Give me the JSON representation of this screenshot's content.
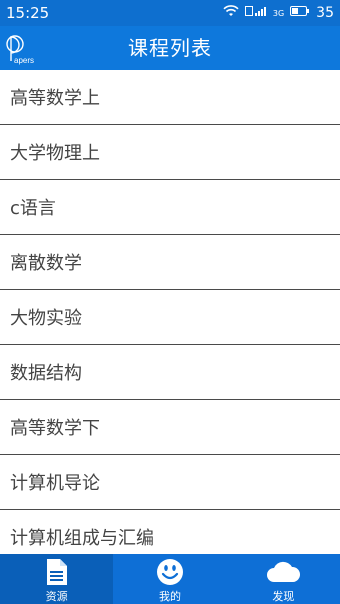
{
  "status_bar": {
    "time": "15:25",
    "battery": "35",
    "network": "3G"
  },
  "header": {
    "title": "课程列表",
    "logo_text": "Papers"
  },
  "courses": [
    {
      "label": "高等数学上"
    },
    {
      "label": "大学物理上"
    },
    {
      "label": "c语言"
    },
    {
      "label": "离散数学"
    },
    {
      "label": "大物实验"
    },
    {
      "label": "数据结构"
    },
    {
      "label": "高等数学下"
    },
    {
      "label": "计算机导论"
    },
    {
      "label": "计算机组成与汇编"
    }
  ],
  "bottom_nav": [
    {
      "label": "资源",
      "icon": "document-icon",
      "active": true
    },
    {
      "label": "我的",
      "icon": "smiley-icon",
      "active": false
    },
    {
      "label": "发现",
      "icon": "cloud-icon",
      "active": false
    }
  ],
  "colors": {
    "status_bar": "#0e6fcf",
    "app_bar": "#0e78dc",
    "bottom_nav": "#0e6fd6",
    "active_tab": "#0a5fb8"
  }
}
